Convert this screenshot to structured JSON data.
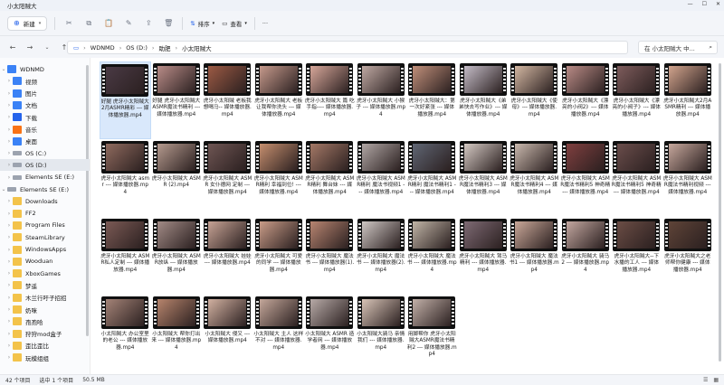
{
  "window": {
    "title": "小太阳贼大"
  },
  "toolbar": {
    "new_label": "新建",
    "sort_label": "排序",
    "view_label": "查看",
    "more_label": "···"
  },
  "address": {
    "path": [
      "WDNMD",
      "OS (D:)",
      "助肥",
      "小太阳贼大"
    ],
    "search_placeholder": "在 小太阳贼大 中..."
  },
  "sidebar": {
    "items": [
      {
        "label": "WDNMD",
        "icon": "user-icon",
        "indent": 0,
        "expanded": true
      },
      {
        "label": "视频",
        "icon": "video-icon",
        "indent": 1
      },
      {
        "label": "图片",
        "icon": "picture-icon",
        "indent": 1
      },
      {
        "label": "文档",
        "icon": "document-icon",
        "indent": 1
      },
      {
        "label": "下载",
        "icon": "download-icon",
        "indent": 1
      },
      {
        "label": "音乐",
        "icon": "music-icon",
        "indent": 1
      },
      {
        "label": "桌面",
        "icon": "desktop-icon",
        "indent": 1
      },
      {
        "label": "OS (C:)",
        "icon": "drive-icon",
        "indent": 1
      },
      {
        "label": "OS (D:)",
        "icon": "drive-icon",
        "indent": 1,
        "selected": true
      },
      {
        "label": "Elements SE (E:)",
        "icon": "drive-icon",
        "indent": 1
      },
      {
        "label": "Elements SE (E:)",
        "icon": "drive-icon",
        "indent": 0,
        "expanded": true
      },
      {
        "label": "Downloads",
        "icon": "folder-icon",
        "indent": 1
      },
      {
        "label": "FF2",
        "icon": "folder-icon",
        "indent": 1
      },
      {
        "label": "Program Files",
        "icon": "folder-icon",
        "indent": 1
      },
      {
        "label": "SteamLibrary",
        "icon": "folder-icon",
        "indent": 1
      },
      {
        "label": "WindowsApps",
        "icon": "folder-icon",
        "indent": 1
      },
      {
        "label": "Wooduan",
        "icon": "folder-icon",
        "indent": 1
      },
      {
        "label": "XboxGames",
        "icon": "folder-icon",
        "indent": 1
      },
      {
        "label": "梦遥",
        "icon": "folder-icon",
        "indent": 1
      },
      {
        "label": "木兰行吁子招招",
        "icon": "folder-icon",
        "indent": 1
      },
      {
        "label": "奶咪",
        "icon": "folder-icon",
        "indent": 1
      },
      {
        "label": "孢孢哈",
        "icon": "folder-icon",
        "indent": 1
      },
      {
        "label": "狩狩mod盒子",
        "icon": "folder-icon",
        "indent": 1
      },
      {
        "label": "歪比歪比",
        "icon": "folder-icon",
        "indent": 1
      },
      {
        "label": "玩模组组",
        "icon": "folder-icon",
        "indent": 1
      }
    ]
  },
  "files": [
    {
      "name": "好腿 虎牙小太阳贼大2月ASMR精彩 --- 媒体播放器.mp4",
      "color": "#4a3a45",
      "selected": true
    },
    {
      "name": "好腿 虎牙小太阳贼大ASMR魔法书精利 --- 媒体播放器.mp4",
      "color": "#b98c88"
    },
    {
      "name": "虎牙小太阳贼 老板我想喝马-- 媒体播放器.mp4",
      "color": "#9c5a44"
    },
    {
      "name": "虎牙小太阳贼大 老板让我帮你洗头 --- 媒体播放器.mp4",
      "color": "#c69a8c"
    },
    {
      "name": "虎牙小太阳贼大 篇 吃手指---- 媒体播放器.mp4",
      "color": "#d7a79a"
    },
    {
      "name": "虎牙小太阳贼大 小猴子 --- 媒体播放器.mp4",
      "color": "#bfa9a3"
    },
    {
      "name": "虎牙小太阳贼大：第一次好紧张 --- 媒体播放器.mp4",
      "color": "#c08f7a"
    },
    {
      "name": "虎牙小太阳贼大《弟弟快去写作业》--- 媒体播放器.mp4",
      "color": "#c4bcc7"
    },
    {
      "name": "虎牙小太阳贼大《使母》--- 媒体播放器.mp4",
      "color": "#d3b7a2"
    },
    {
      "name": "虎牙小太阳贼大《漂亮的小阀2》--- 媒体播放器.mp4",
      "color": "#b98b86"
    },
    {
      "name": "虎牙小太阳贼大《漂亮的小阀子》--- 媒体播放器.mp4",
      "color": "#7e5c5c"
    },
    {
      "name": "虎牙小太阳贼大2月ASMR精利 --- 媒体播放器.mp4",
      "color": "#d2a48d"
    },
    {
      "name": "虎牙小太阳贼大 asmr --- 媒体播放器.mp4",
      "color": "#8f6a5e"
    },
    {
      "name": "虎牙小太阳贼大 ASMR (2).mp4",
      "color": "#b59a8e"
    },
    {
      "name": "虎牙小太阳贼大 ASMR 女仆德网 定制 --- 媒体播放器.mp4",
      "color": "#6e5553"
    },
    {
      "name": "虎牙小太阳贼大 ASMR精利 幸福到位! --- 媒体播放器.mp4",
      "color": "#c58e6e"
    },
    {
      "name": "虎牙小太阳贼大 ASMR精利 舞台妹 --- 媒体播放器.mp4",
      "color": "#a47866"
    },
    {
      "name": "虎牙小太阳贼大 ASMR精利 魔法书视频1 --- 媒体播放器.mp4",
      "color": "#b0a6a4"
    },
    {
      "name": "虎牙小太阳贼大 ASMR精利 魔法书精利1 --- 媒体播放器.mp4",
      "color": "#5f6573"
    },
    {
      "name": "虎牙小太阳贼大 ASMR魔法书精利3 --- 媒体播放器.mp4",
      "color": "#d4c9c3"
    },
    {
      "name": "虎牙小太阳贼大 ASMR魔法书精利4 --- 媒体播放器.mp4",
      "color": "#c9b8ad"
    },
    {
      "name": "虎牙小太阳贼大 ASMR魔法书精利5 神奇精 --- 媒体播放器.mp4",
      "color": "#7f3f3f"
    },
    {
      "name": "虎牙小太阳贼大 ASMR魔法书精利5 神奇精 --- 媒体播放器.mp4",
      "color": "#6a4d4b"
    },
    {
      "name": "虎牙小太阳贼大 ASMR魔法书精利视频 --- 媒体播放器.mp4",
      "color": "#c6a79c"
    },
    {
      "name": "虎牙小太阳贼大 ASMR私人定制 --- 媒体播放器.mp4",
      "color": "#7b5a55"
    },
    {
      "name": "虎牙小太阳贼大 ASMR放纵 --- 媒体播放器.mp4",
      "color": "#a28b86"
    },
    {
      "name": "虎牙小太阳贼大 娃娃 --- 媒体播放器.mp4",
      "color": "#c7a395"
    },
    {
      "name": "虎牙小太阳贼大 可爱的同学 --- 媒体播放器.mp4",
      "color": "#c99c88"
    },
    {
      "name": "虎牙小太阳贼大 魔法书 --- 媒体播放器(1).mp4",
      "color": "#b88571"
    },
    {
      "name": "虎牙小太阳贼大 魔法书 --- 媒体播放器(2).mp4",
      "color": "#cfc7c4"
    },
    {
      "name": "虎牙小太阳贼大 魔法书 --- 媒体播放器.mp4",
      "color": "#c0b4a6"
    },
    {
      "name": "虎牙小太阳贼大 驾马精利 --- 媒体播放器.mp4",
      "color": "#7e6a74"
    },
    {
      "name": "虎牙小太阳贼大 魔法书1 --- 媒体播放器.mp4",
      "color": "#caa899"
    },
    {
      "name": "虎牙小太阳贼大 骑马2 --- 媒体播放器.mp4",
      "color": "#c3a7a0"
    },
    {
      "name": "虎牙小太阳贼大--下水播的工人 --- 媒体播放器.mp4",
      "color": "#6b4d45"
    },
    {
      "name": "虎牙小太阳贼大之老师帮你健康 --- 媒体播放器.mp4",
      "color": "#5f4438"
    },
    {
      "name": "小太阳贼大 办公室里的老公 --- 媒体播放器.mp4",
      "color": "#a48377"
    },
    {
      "name": "小太阳贼大 帮你打出来 --- 媒体播放器.mp4",
      "color": "#b7846c"
    },
    {
      "name": "小太阳贼大 侵又 --- 媒体播放器.mp4",
      "color": "#d2b1a1"
    },
    {
      "name": "小太阳贼大 主人 这样不对 --- 媒体播放器.mp4",
      "color": "#c4a79a"
    },
    {
      "name": "小太阳贼大 ASMR 造学者网 --- 媒体播放器.mp4",
      "color": "#b7aaa7"
    },
    {
      "name": "小太阳贼大骑马 亲情我们 --- 媒体播放器.mp4",
      "color": "#d8c4b7"
    },
    {
      "name": "用脚帮你 虎牙小太阳贼大ASMR魔法书精利2 --- 媒体播放器.mp4",
      "color": "#c2b0a8"
    }
  ],
  "status": {
    "count": "42 个项目",
    "selected": "选中 1 个项目",
    "size": "50.5 MB"
  }
}
